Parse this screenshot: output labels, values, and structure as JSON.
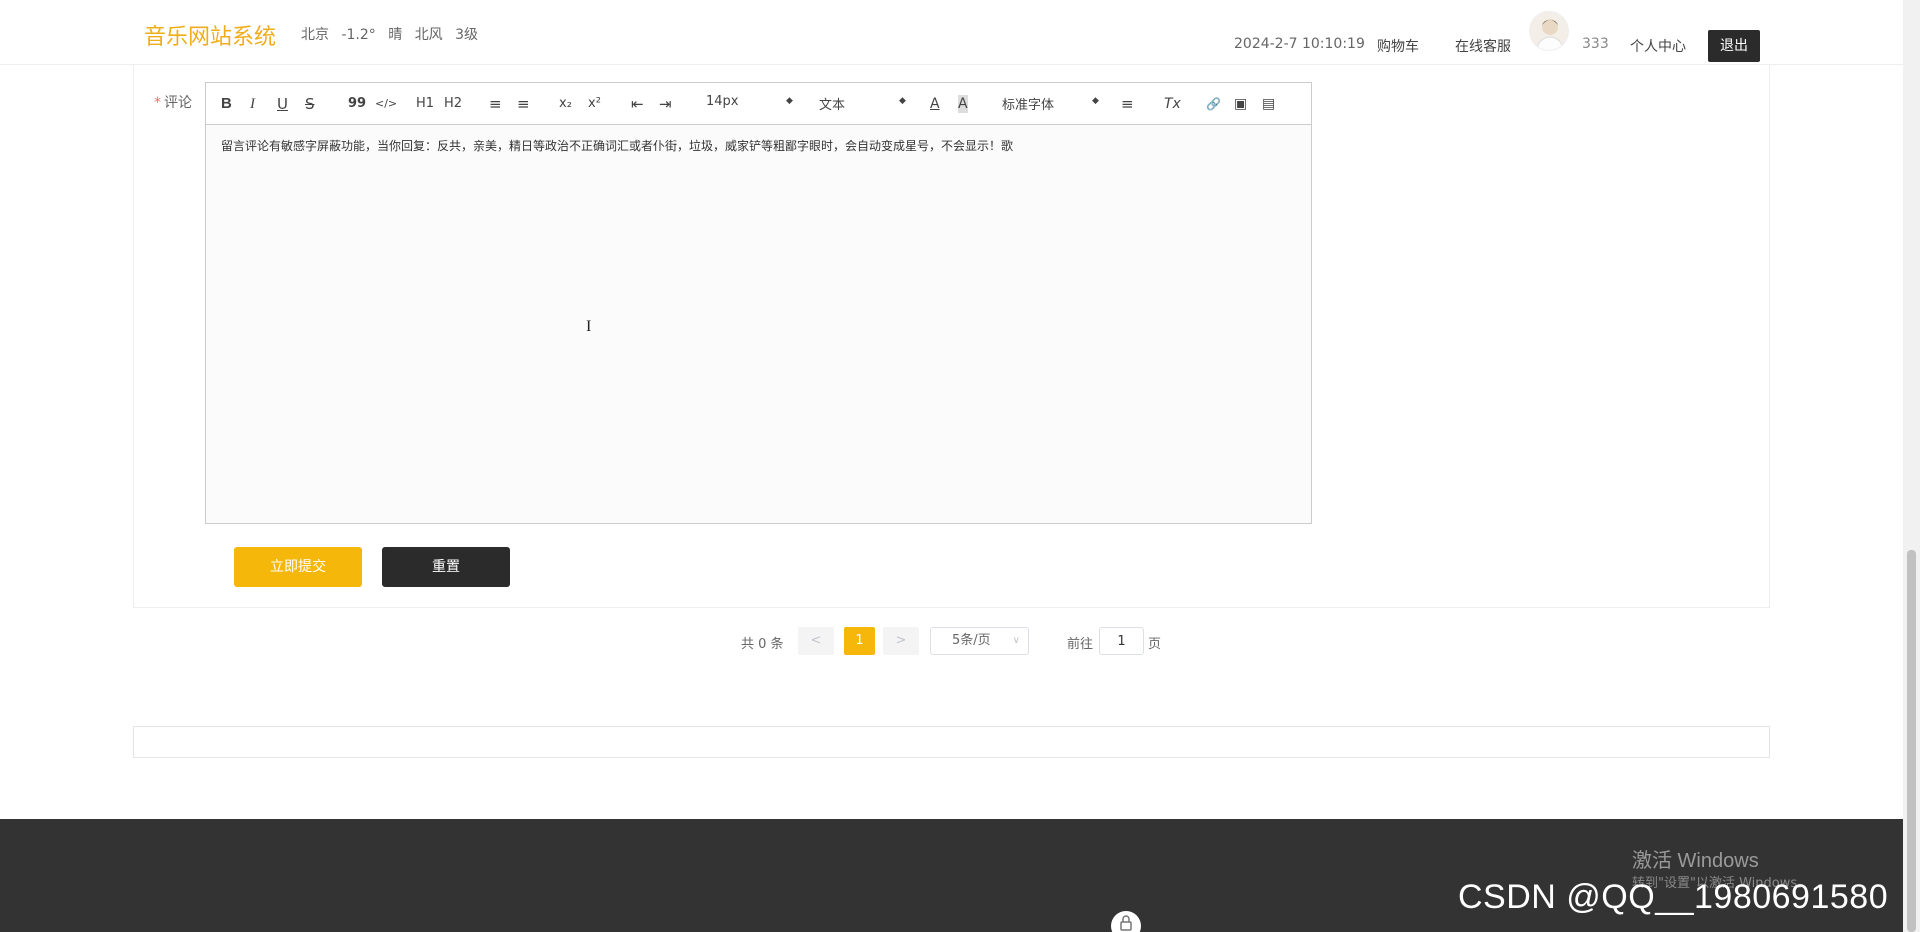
{
  "header": {
    "logo": "音乐网站系统",
    "weather": {
      "city": "北京",
      "temp": "-1.2°",
      "condition": "晴",
      "wind": "北风",
      "level": "3级"
    },
    "datetime": "2024-2-7 10:10:19",
    "cart_label": "购物车",
    "service_label": "在线客服",
    "username": "333",
    "profile_label": "个人中心",
    "logout_label": "退出"
  },
  "form": {
    "comment_label": "评论",
    "required_mark": "*",
    "toolbar": {
      "bold": "B",
      "italic": "I",
      "underline": "U",
      "strike": "S",
      "quote": "99",
      "code": "</>",
      "h1": "H1",
      "h2": "H2",
      "ordered_list": "≡",
      "bullet_list": "≡",
      "subscript": "x₂",
      "superscript": "x²",
      "outdent": "⇤",
      "indent": "⇥",
      "size_value": "14px",
      "block_value": "文本",
      "font_value": "标准字体",
      "color": "A",
      "background": "A",
      "align": "≡",
      "clear": "Tx",
      "link": "🔗",
      "image": "▣",
      "video": "▤"
    },
    "editor_text": "留言评论有敏感字屏蔽功能，当你回复：反共，亲美，精日等政治不正确词汇或者仆街，垃圾，威家铲等粗鄙字眼时，会自动变成星号，不会显示！歌",
    "submit_label": "立即提交",
    "reset_label": "重置"
  },
  "pagination": {
    "total_text": "共 0 条",
    "prev": "<",
    "current": "1",
    "next": ">",
    "page_size": "5条/页",
    "goto_label": "前往",
    "goto_value": "1",
    "page_suffix": "页"
  },
  "overlay": {
    "activate_title": "激活 Windows",
    "activate_sub": "转到\"设置\"以激活 Windows。",
    "watermark": "CSDN @QQ__1980691580"
  },
  "colors": {
    "accent": "#f5b80a",
    "dark": "#2b2b2b",
    "footer": "#333333"
  }
}
